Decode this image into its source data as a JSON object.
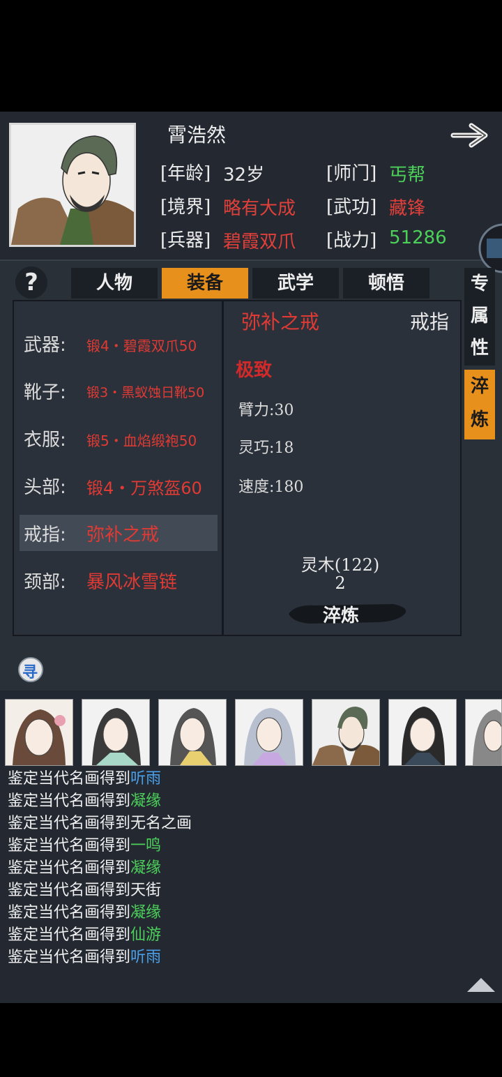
{
  "character": {
    "name": "霄浩然",
    "age_label": "[年龄]",
    "age": "32岁",
    "sect_label": "[师门]",
    "sect": "丐帮",
    "realm_label": "[境界]",
    "realm": "略有大成",
    "skill_label": "[武功]",
    "skill": "藏锋",
    "weapon_label": "[兵器]",
    "weapon": "碧霞双爪",
    "power_label": "[战力]",
    "power": "51286"
  },
  "tabs": [
    "人物",
    "装备",
    "武学",
    "顿悟"
  ],
  "side_tabs": [
    "专",
    "属",
    "性",
    "淬",
    "炼"
  ],
  "help_label": "?",
  "equipment": [
    {
      "slot": "武器:",
      "item": "锻4・碧霞双爪50"
    },
    {
      "slot": "靴子:",
      "item": "锻3・黑蚁蚀日靴50"
    },
    {
      "slot": "衣服:",
      "item": "锻5・血焰缎袍50"
    },
    {
      "slot": "头部:",
      "item": "锻4・万煞盔60"
    },
    {
      "slot": "戒指:",
      "item": "弥补之戒"
    },
    {
      "slot": "颈部:",
      "item": "暴风冰雪链"
    }
  ],
  "detail": {
    "name": "弥补之戒",
    "type": "戒指",
    "grade": "极致",
    "stats": [
      "臂力:30",
      "灵巧:18",
      "速度:180"
    ],
    "material": "灵木(122)",
    "material_cost": "2",
    "refine_label": "淬炼"
  },
  "search_icon_glyph": "寻",
  "log": [
    {
      "prefix": "鉴定当代名画得到",
      "name": "听雨",
      "color": "#4aa0e8"
    },
    {
      "prefix": "鉴定当代名画得到",
      "name": "凝缘",
      "color": "#4cd05a"
    },
    {
      "prefix": "鉴定当代名画得到",
      "name": "无名之画",
      "color": "#f0f0f0"
    },
    {
      "prefix": "鉴定当代名画得到",
      "name": "一鸣",
      "color": "#4cd05a"
    },
    {
      "prefix": "鉴定当代名画得到",
      "name": "凝缘",
      "color": "#4cd05a"
    },
    {
      "prefix": "鉴定当代名画得到",
      "name": "天街",
      "color": "#f0f0f0"
    },
    {
      "prefix": "鉴定当代名画得到",
      "name": "凝缘",
      "color": "#4cd05a"
    },
    {
      "prefix": "鉴定当代名画得到",
      "name": "仙游",
      "color": "#4cd05a"
    },
    {
      "prefix": "鉴定当代名画得到",
      "name": "听雨",
      "color": "#4aa0e8"
    }
  ],
  "colors": {
    "accent": "#e8901c",
    "item_red": "#e03a34",
    "sect_green": "#4cd05a",
    "panel": "#2b313a"
  }
}
